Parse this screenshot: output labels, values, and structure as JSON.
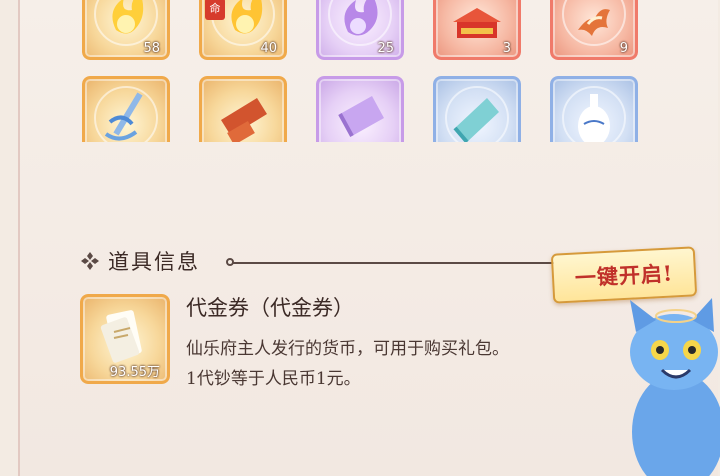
{
  "items_row1": [
    {
      "name": "fire-orb",
      "count": "58",
      "tier": "orange"
    },
    {
      "name": "fire-orb-seal",
      "count": "40",
      "tier": "orange"
    },
    {
      "name": "violet-flame",
      "count": "25",
      "tier": "purple"
    },
    {
      "name": "red-pavilion",
      "count": "3",
      "tier": "red"
    },
    {
      "name": "ember-dragon",
      "count": "9",
      "tier": "red"
    }
  ],
  "items_row2": [
    {
      "name": "frost-sword",
      "tier": "orange"
    },
    {
      "name": "red-scroll",
      "tier": "orange"
    },
    {
      "name": "violet-scroll",
      "tier": "purple"
    },
    {
      "name": "jade-scroll",
      "tier": "blue"
    },
    {
      "name": "porcelain-vase",
      "tier": "blue"
    }
  ],
  "seal_glyph": "命",
  "section": {
    "title": "道具信息"
  },
  "open_all_label": "一键开启!",
  "detail": {
    "name": "代金券（代金券）",
    "count": "93.55万",
    "desc_line1": "仙乐府主人发行的货币，可用于购买礼包。",
    "desc_line2": "1代钞等于人民币1元。"
  },
  "colors": {
    "accent_red": "#c0302a",
    "gold": "#d69a3a"
  }
}
